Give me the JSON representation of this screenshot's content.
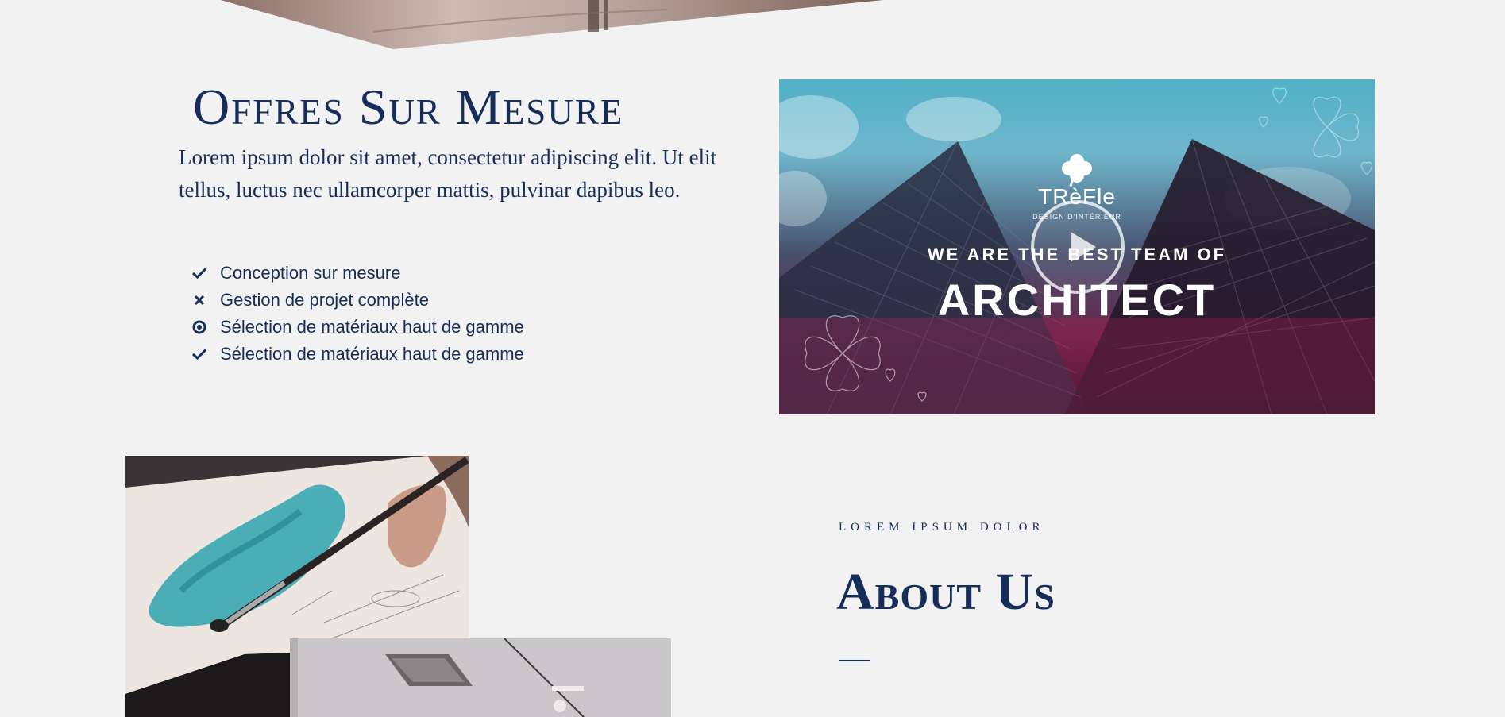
{
  "offres": {
    "title": "Offres Sur Mesure",
    "text": "Lorem ipsum dolor sit amet, consectetur adipiscing elit. Ut elit tellus, luctus nec ullamcorper mattis, pulvinar dapibus leo.",
    "features": [
      {
        "icon": "check-icon",
        "label": "Conception sur mesure"
      },
      {
        "icon": "times-icon",
        "label": "Gestion de projet complète"
      },
      {
        "icon": "dot-circle-icon",
        "label": "Sélection de matériaux haut de gamme"
      },
      {
        "icon": "check-icon",
        "label": "Sélection de matériaux haut de gamme"
      }
    ]
  },
  "video": {
    "brand": "TRèFle",
    "brand_sub": "DESIGN D'INTÉRIEUR",
    "tagline": "WE ARE THE BEST TEAM OF",
    "headline": "ARCHITECT",
    "play_icon": "play-icon"
  },
  "about": {
    "eyebrow": "LOREM IPSUM DOLOR",
    "title": "About Us"
  },
  "colors": {
    "primary": "#162d5a",
    "background": "#f2f2f2"
  }
}
